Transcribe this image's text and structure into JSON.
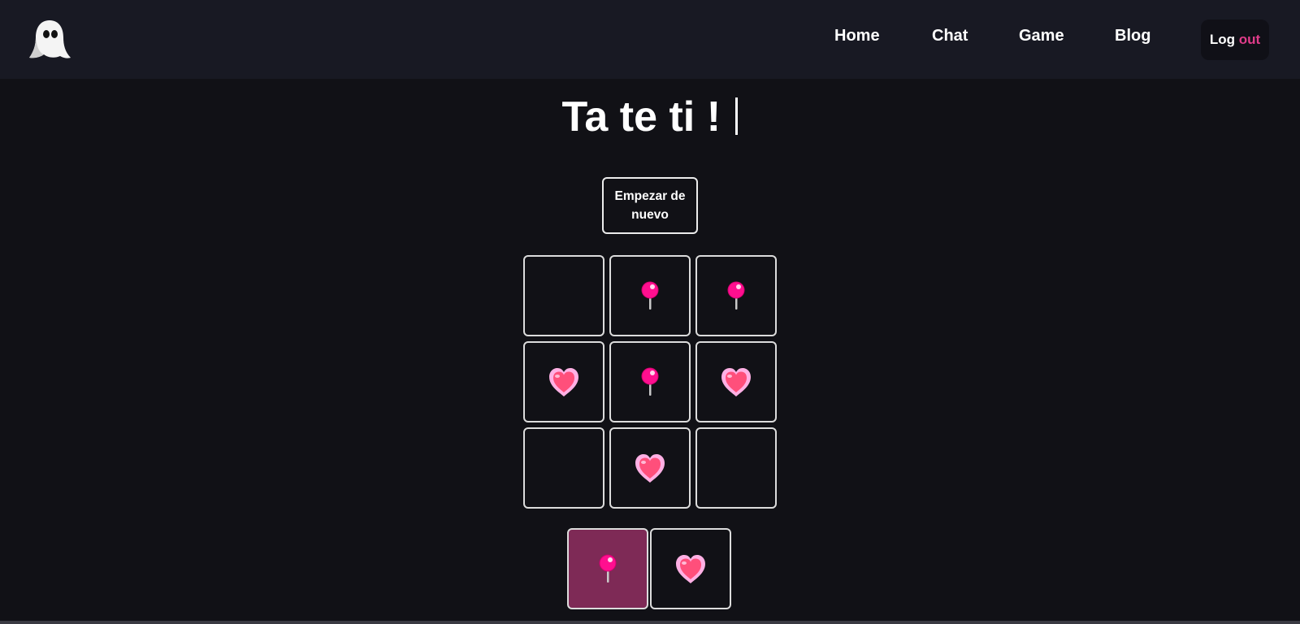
{
  "nav": {
    "logo_icon": "ghost-icon",
    "links": [
      {
        "label": "Home"
      },
      {
        "label": "Chat"
      },
      {
        "label": "Game"
      },
      {
        "label": "Blog"
      }
    ],
    "logout": {
      "part1": "Log",
      "part2": "out"
    }
  },
  "game": {
    "title": "Ta te ti !",
    "restart_label": "Empezar de nuevo",
    "board": [
      "",
      "pushpin",
      "pushpin",
      "heart",
      "pushpin",
      "heart",
      "",
      "heart",
      ""
    ],
    "turns": [
      {
        "piece": "pushpin",
        "active": true
      },
      {
        "piece": "heart",
        "active": false
      }
    ]
  },
  "colors": {
    "background": "#111116",
    "navbar": "#181923",
    "accent": "#e03c8a",
    "active_turn": "#7e2a56",
    "pushpin": "#ff0f8f",
    "heart": "#ff4f7b"
  }
}
